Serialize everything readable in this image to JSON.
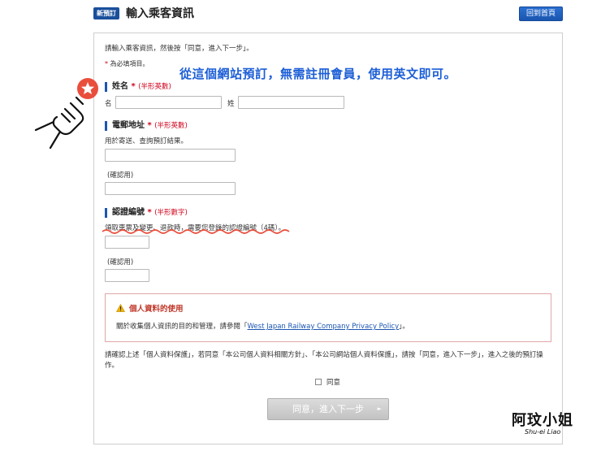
{
  "header": {
    "badge": "新預訂",
    "title": "輸入乘客資訊",
    "home_button": "回到首頁"
  },
  "intro": "請輸入乘客資訊，然後按「同意，進入下一步」。",
  "required_note": {
    "star": "*",
    "text": "為必填項目。"
  },
  "annotation": "從這個網站預訂，無需註冊會員，使用英文即可。",
  "name_section": {
    "title": "姓名",
    "star": "*",
    "hint": "(半形英數)",
    "first_label": "名",
    "last_label": "姓",
    "first_value": "",
    "last_value": ""
  },
  "email_section": {
    "title": "電郵地址",
    "star": "*",
    "hint": "(半形英數)",
    "desc": "用於寄送、查詢預訂結果。",
    "email_value": "",
    "confirm_label": "(確認用)",
    "confirm_value": ""
  },
  "pin_section": {
    "title": "認證編號",
    "star": "*",
    "hint": "(半形數字)",
    "desc": "領取車票及變更、退款時，需要您登錄的認證編號（4碼）。",
    "pin_value": "",
    "confirm_label": "(確認用)",
    "confirm_value": ""
  },
  "privacy": {
    "title": "個人資料的使用",
    "text_before": "關於收集個人資訊的目的和管理，請參閱「",
    "link": "West Japan Railway Company Privacy Policy",
    "text_after": "」。"
  },
  "confirm_text": "請確認上述「個人資料保護」，若同意「本公司個人資料相關方針」、「本公司網站個人資料保護」，請按「同意，進入下一步」，進入之後的預訂操作。",
  "agree_label": "同意",
  "agree_checked": false,
  "next_button": "同意，進入下一步",
  "signature": {
    "main": "阿玟小姐",
    "sub": "Shu-ei Liao"
  },
  "colors": {
    "brand_blue": "#1a56b0",
    "required_red": "#d0021b",
    "annotation_blue": "#1d5fd6",
    "marker_red": "#e94e3c"
  }
}
